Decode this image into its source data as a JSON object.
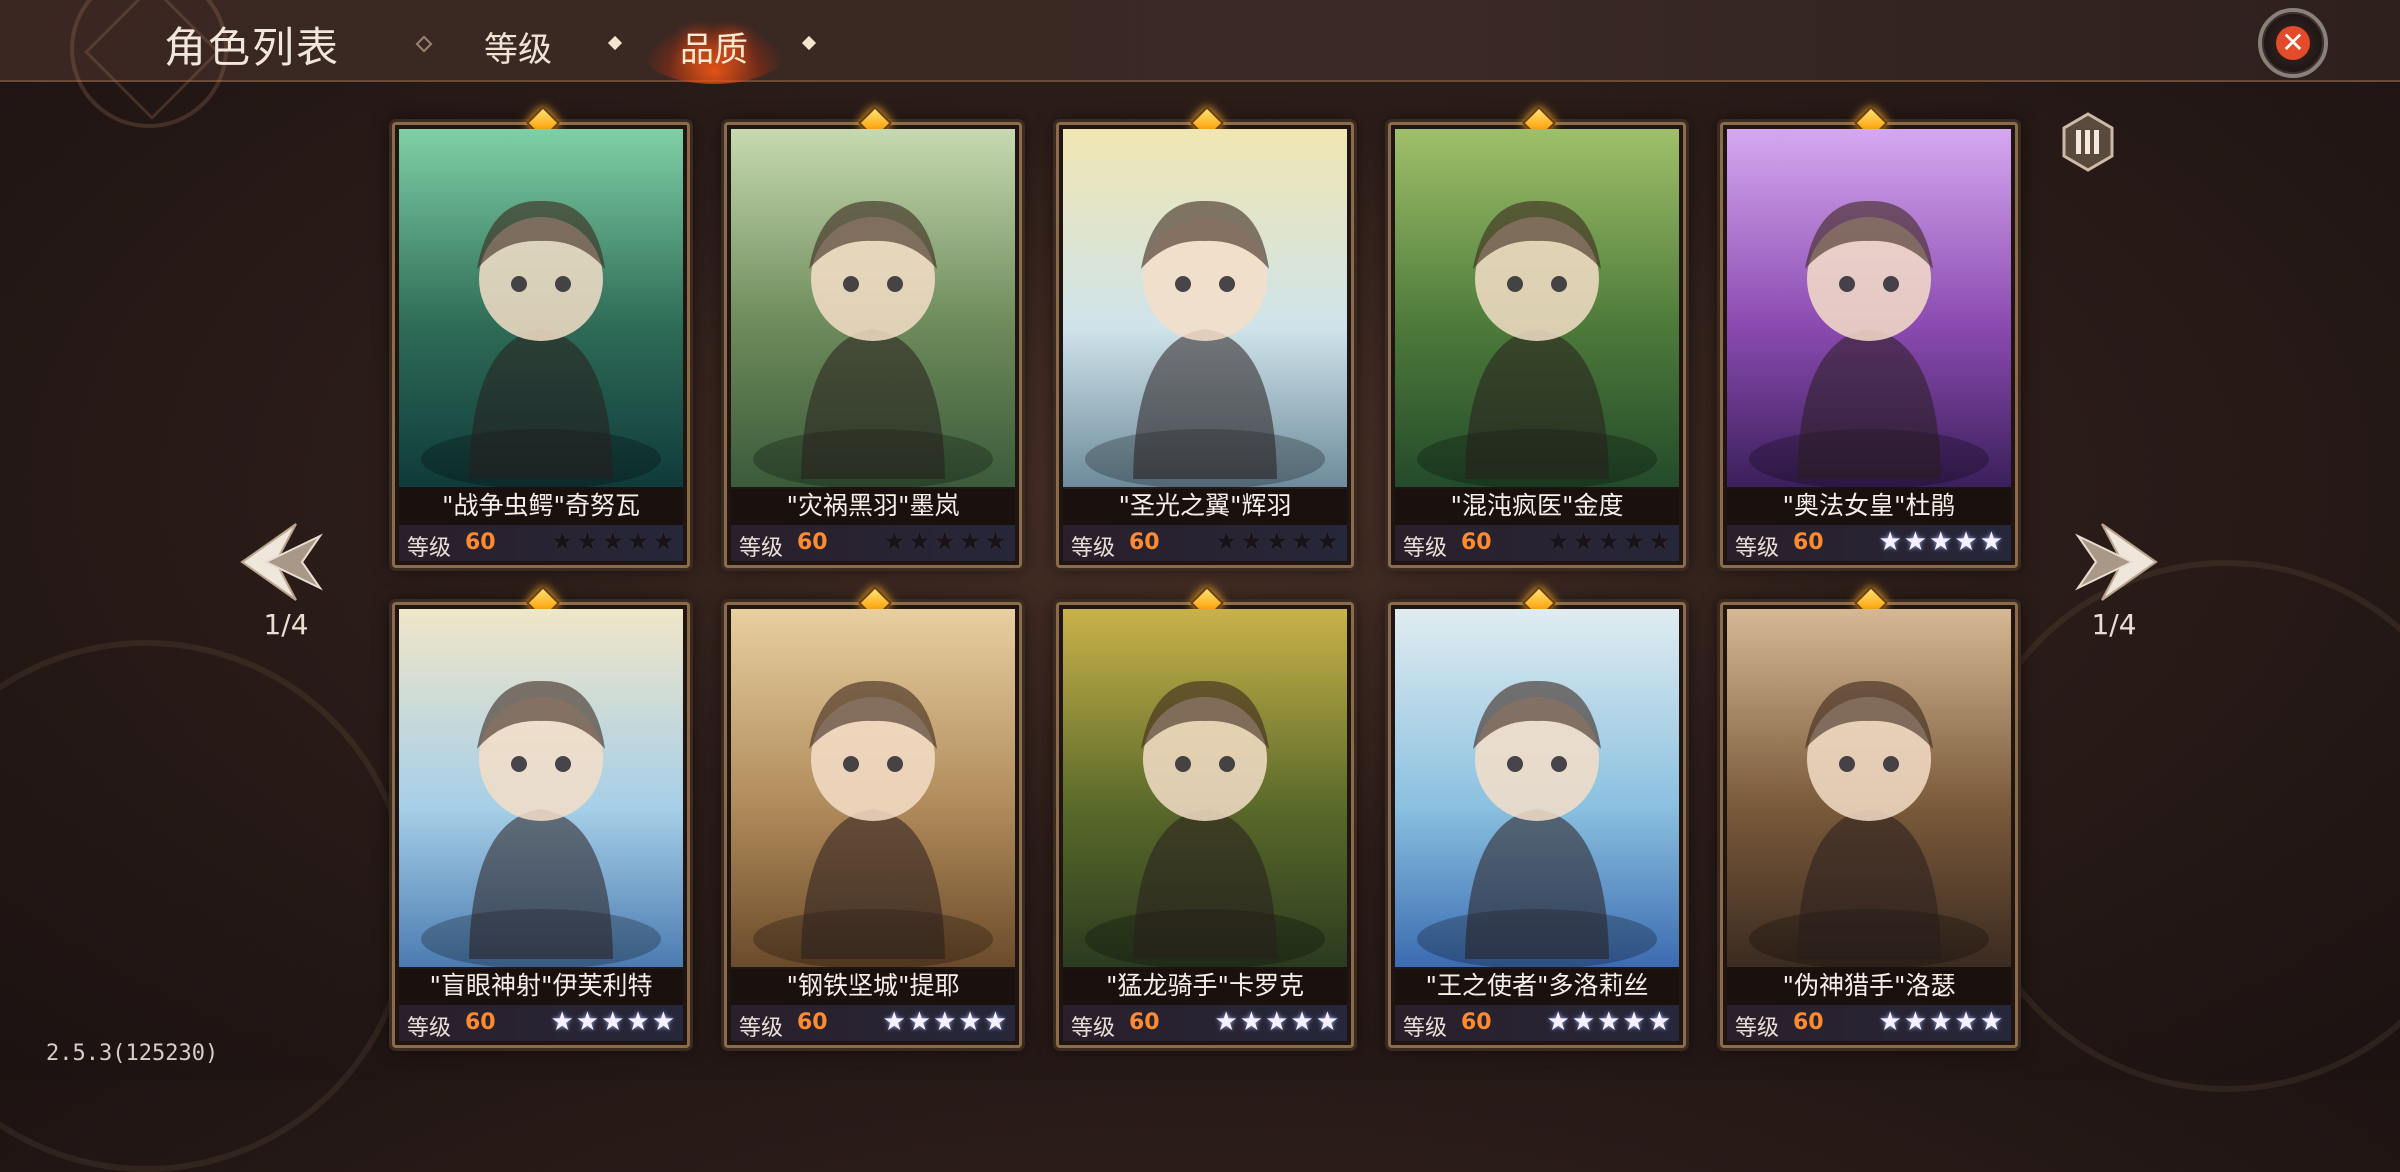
{
  "header": {
    "title": "角色列表",
    "tabs": [
      {
        "label": "等级",
        "active": false
      },
      {
        "label": "品质",
        "active": true
      }
    ]
  },
  "pagination": {
    "left_label": "1/4",
    "right_label": "1/4"
  },
  "version": "2.5.3(125230)",
  "colors": {
    "accent": "#ff5a1a",
    "level_value": "#ff8b2e",
    "close_icon": "#e34b2a",
    "gem": "#ffb12e"
  },
  "characters": [
    {
      "name": "\"战争虫鳄\"奇努瓦",
      "level_label": "等级",
      "level": "60",
      "stars": "★★★★★",
      "stars_lit": 0
    },
    {
      "name": "\"灾祸黑羽\"墨岚",
      "level_label": "等级",
      "level": "60",
      "stars": "★★★★★",
      "stars_lit": 0
    },
    {
      "name": "\"圣光之翼\"辉羽",
      "level_label": "等级",
      "level": "60",
      "stars": "★★★★★",
      "stars_lit": 0
    },
    {
      "name": "\"混沌疯医\"金度",
      "level_label": "等级",
      "level": "60",
      "stars": "★★★★★",
      "stars_lit": 0
    },
    {
      "name": "\"奥法女皇\"杜鹃",
      "level_label": "等级",
      "level": "60",
      "stars": "★★★★★",
      "stars_lit": 5
    },
    {
      "name": "\"盲眼神射\"伊芙利特",
      "level_label": "等级",
      "level": "60",
      "stars": "★★★★★",
      "stars_lit": 5
    },
    {
      "name": "\"钢铁坚城\"提耶",
      "level_label": "等级",
      "level": "60",
      "stars": "★★★★★",
      "stars_lit": 5
    },
    {
      "name": "\"猛龙骑手\"卡罗克",
      "level_label": "等级",
      "level": "60",
      "stars": "★★★★★",
      "stars_lit": 5
    },
    {
      "name": "\"王之使者\"多洛莉丝",
      "level_label": "等级",
      "level": "60",
      "stars": "★★★★★",
      "stars_lit": 5
    },
    {
      "name": "\"伪神猎手\"洛瑟",
      "level_label": "等级",
      "level": "60",
      "stars": "★★★★★",
      "stars_lit": 5
    }
  ],
  "icons": {
    "close": "close-icon",
    "prev": "chevron-left-icon",
    "next": "chevron-right-icon",
    "filter": "filter-icon",
    "rarity": "gem-icon"
  }
}
